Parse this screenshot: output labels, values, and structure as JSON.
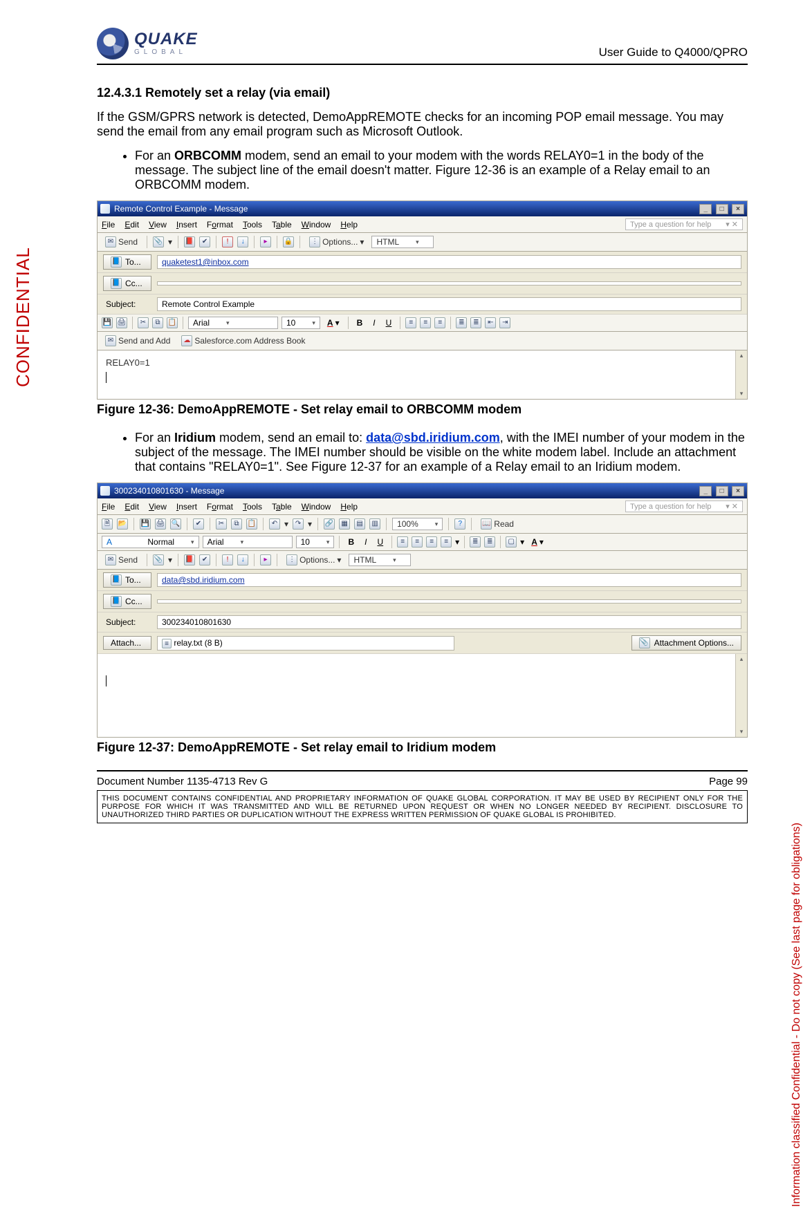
{
  "header": {
    "brand_main": "QUAKE",
    "brand_sub": "GLOBAL",
    "doc_title": "User Guide to Q4000/QPRO"
  },
  "side_left": "CONFIDENTIAL",
  "side_right": "Information classified Confidential - Do not copy (See last page for obligations)",
  "watermark": "",
  "section": {
    "heading": "12.4.3.1 Remotely set a relay (via email)",
    "intro": "If the GSM/GPRS network is detected, DemoAppREMOTE checks for an incoming POP email message.  You may send the email from any email program such as Microsoft Outlook.",
    "bullet1_pre": "For an ",
    "bullet1_bold": "ORBCOMM",
    "bullet1_post": " modem, send an email to your modem with the words RELAY0=1 in the body of the message.  The subject line of the email doesn't matter.  Figure 12-36 is an example of a Relay email to an ORBCOMM modem.",
    "fig1_caption": "Figure 12-36:  DemoAppREMOTE - Set relay email to ORBCOMM modem",
    "bullet2_pre": "For an ",
    "bullet2_bold": "Iridium",
    "bullet2_mid": " modem, send an email to: ",
    "bullet2_link": "data@sbd.iridium.com",
    "bullet2_post": ", with the IMEI number of your modem in the subject of the message.  The IMEI number should be visible on the white modem label.  Include an attachment that contains \"RELAY0=1\".  See Figure 12-37 for an example of a Relay email to an Iridium modem.",
    "fig2_caption": "Figure 12-37:  DemoAppREMOTE - Set relay email to Iridium modem"
  },
  "win1": {
    "title": "Remote Control Example - Message",
    "menus": [
      "File",
      "Edit",
      "View",
      "Insert",
      "Format",
      "Tools",
      "Table",
      "Window",
      "Help"
    ],
    "help_placeholder": "Type a question for help",
    "send": "Send",
    "options": "Options...",
    "format_sel": "HTML",
    "to_label": "To...",
    "to_val": "quaketest1@inbox.com",
    "cc_label": "Cc...",
    "subj_label": "Subject:",
    "subj_val": "Remote Control Example",
    "font": "Arial",
    "size": "10",
    "send_add": "Send and Add",
    "sf_book": "Salesforce.com Address Book",
    "body": "RELAY0=1"
  },
  "win2": {
    "title": "300234010801630 - Message",
    "menus": [
      "File",
      "Edit",
      "View",
      "Insert",
      "Format",
      "Tools",
      "Table",
      "Window",
      "Help"
    ],
    "help_placeholder": "Type a question for help",
    "zoom": "100%",
    "read": "Read",
    "style": "Normal",
    "font": "Arial",
    "size": "10",
    "send": "Send",
    "options": "Options...",
    "format_sel": "HTML",
    "to_label": "To...",
    "to_val": "data@sbd.iridium.com",
    "cc_label": "Cc...",
    "subj_label": "Subject:",
    "subj_val": "300234010801630",
    "attach_label": "Attach...",
    "attach_val": "relay.txt (8 B)",
    "attach_opt": "Attachment Options..."
  },
  "footer": {
    "docnum": "Document Number 1135-4713   Rev G",
    "page": "Page 99",
    "legal": "THIS DOCUMENT CONTAINS CONFIDENTIAL AND PROPRIETARY INFORMATION OF QUAKE GLOBAL CORPORATION.  IT MAY BE USED BY RECIPIENT ONLY FOR THE PURPOSE FOR WHICH IT WAS TRANSMITTED AND WILL BE RETURNED UPON REQUEST OR WHEN NO LONGER NEEDED BY RECIPIENT.  DISCLOSURE TO UNAUTHORIZED THIRD PARTIES OR DUPLICATION WITHOUT THE EXPRESS WRITTEN PERMISSION OF QUAKE GLOBAL IS PROHIBITED."
  }
}
